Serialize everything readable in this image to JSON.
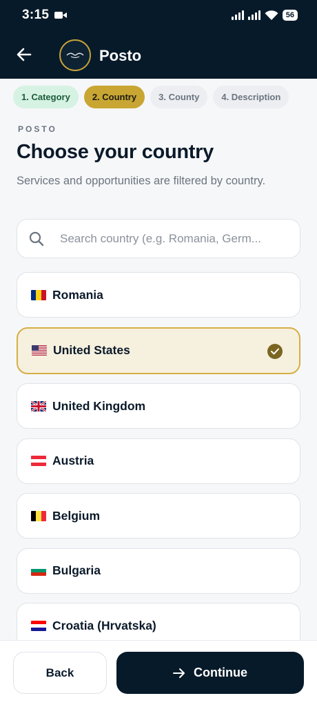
{
  "status_bar": {
    "time": "3:15",
    "battery": "56"
  },
  "header": {
    "title": "Posto"
  },
  "stepper": [
    {
      "label": "1. Category",
      "state": "done"
    },
    {
      "label": "2. Country",
      "state": "active"
    },
    {
      "label": "3. County",
      "state": "todo"
    },
    {
      "label": "4. Description",
      "state": "todo"
    }
  ],
  "page": {
    "eyebrow": "POSTO",
    "title": "Choose your country",
    "subtitle": "Services and opportunities are filtered by country."
  },
  "search": {
    "placeholder": "Search country (e.g. Romania, Germ...",
    "value": ""
  },
  "countries": [
    {
      "name": "Romania",
      "flag_colors": [
        "#002b7f",
        "#fcd116",
        "#ce1126"
      ],
      "flag_dir": "vertical",
      "selected": false
    },
    {
      "name": "United States",
      "flag_colors": [
        "#b22234",
        "#ffffff",
        "#3c3b6e"
      ],
      "flag_dir": "us",
      "selected": true
    },
    {
      "name": "United Kingdom",
      "flag_colors": [
        "#012169",
        "#ffffff",
        "#c8102e"
      ],
      "flag_dir": "uk",
      "selected": false
    },
    {
      "name": "Austria",
      "flag_colors": [
        "#ed2939",
        "#ffffff",
        "#ed2939"
      ],
      "flag_dir": "horizontal",
      "selected": false
    },
    {
      "name": "Belgium",
      "flag_colors": [
        "#000000",
        "#fae042",
        "#ed2939"
      ],
      "flag_dir": "vertical",
      "selected": false
    },
    {
      "name": "Bulgaria",
      "flag_colors": [
        "#ffffff",
        "#00966e",
        "#d62612"
      ],
      "flag_dir": "horizontal",
      "selected": false
    },
    {
      "name": "Croatia (Hrvatska)",
      "flag_colors": [
        "#ff0000",
        "#ffffff",
        "#171796"
      ],
      "flag_dir": "horizontal",
      "selected": false
    }
  ],
  "footer": {
    "back_label": "Back",
    "continue_label": "Continue"
  },
  "colors": {
    "navy": "#071a2a",
    "gold": "#c9a633",
    "green_pill": "#d6f2e2"
  }
}
